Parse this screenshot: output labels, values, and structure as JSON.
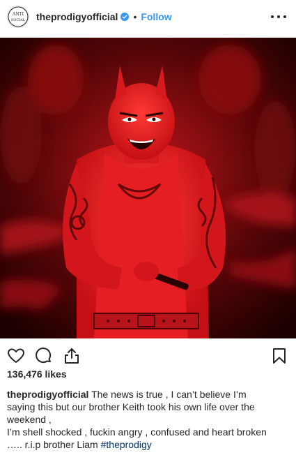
{
  "header": {
    "avatar_text_1": "ANTI",
    "avatar_text_2": "SOCIAL",
    "username": "theprodigyofficial",
    "separator": "•",
    "follow_label": "Follow"
  },
  "post": {
    "likes": "136,476 likes",
    "caption": {
      "username": "theprodigyofficial",
      "line1": "The news is true , I can’t believe I’m",
      "line2": "saying this but our brother Keith took his own life over the",
      "line3": "weekend ,",
      "line4": "I’m shell shocked , fuckin angry , confused and heart broken",
      "line5": "….. r.i.p brother Liam",
      "hashtag": "#theprodigy"
    }
  },
  "colors": {
    "accent": "#3897f0",
    "verified": "#3897f0",
    "text": "#262626",
    "hashtag": "#003569",
    "photo_red": "#e0141a"
  },
  "icons": {
    "verified": "verified-badge-icon",
    "more": "more-options-icon",
    "like": "heart-icon",
    "comment": "comment-icon",
    "share": "share-icon",
    "save": "bookmark-icon"
  }
}
